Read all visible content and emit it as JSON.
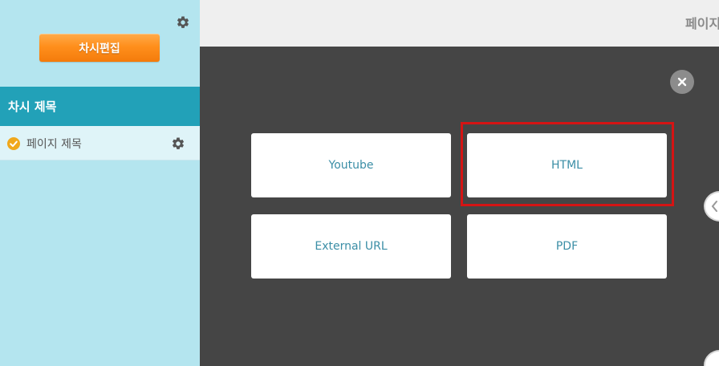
{
  "sidebar": {
    "edit_button_label": "차시편집",
    "chapter_title": "차시 제목",
    "pages": [
      {
        "label": "페이지 제목",
        "status": "complete"
      }
    ],
    "gear_icon": "gear-icon",
    "check_icon": "check-circle-icon"
  },
  "topbar": {
    "title": "페이지 제목"
  },
  "modal": {
    "options": [
      {
        "label": "Youtube"
      },
      {
        "label": "HTML"
      },
      {
        "label": "External URL"
      },
      {
        "label": "PDF"
      }
    ],
    "highlighted_option": "HTML",
    "close_icon": "close-icon"
  },
  "colors": {
    "sidebar_bg": "#b4e5ef",
    "chapter_header_bg": "#22a1b8",
    "edit_button": "#ff8f1c",
    "modal_bg": "#454545",
    "option_text": "#3b8ea6",
    "highlight_border": "#d51414"
  }
}
